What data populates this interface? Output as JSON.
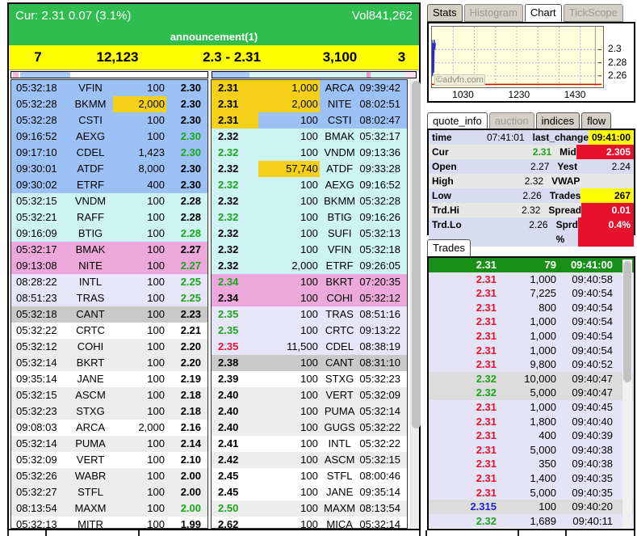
{
  "header": {
    "cur_text": "Cur: 2.31  0.07  (3.1%)",
    "vol_text": "Vol841,262",
    "announcement": "announcement(1)",
    "summary": [
      "7",
      "12,123",
      "2.3 - 2.31",
      "3,100",
      "3"
    ]
  },
  "book": {
    "bid_rows": [
      {
        "t": "05:32:18",
        "mm": "VFIN",
        "sz": "100",
        "p": "2.30",
        "lv": "blue"
      },
      {
        "t": "05:32:28",
        "mm": "BKMM",
        "sz": "2,000",
        "p": "2.30",
        "lv": "blue",
        "szhl": true
      },
      {
        "t": "05:32:28",
        "mm": "CSTI",
        "sz": "100",
        "p": "2.30",
        "lv": "blue"
      },
      {
        "t": "09:16:52",
        "mm": "AEXG",
        "sz": "100",
        "p": "2.30",
        "lv": "blue",
        "pc": "g"
      },
      {
        "t": "09:17:10",
        "mm": "CDEL",
        "sz": "1,423",
        "p": "2.30",
        "lv": "blue",
        "pc": "g"
      },
      {
        "t": "09:30:01",
        "mm": "ATDF",
        "sz": "8,000",
        "p": "2.30",
        "lv": "blue"
      },
      {
        "t": "09:30:02",
        "mm": "ETRF",
        "sz": "400",
        "p": "2.30",
        "lv": "blue"
      },
      {
        "t": "05:32:15",
        "mm": "VNDM",
        "sz": "100",
        "p": "2.28",
        "lv": "cyan"
      },
      {
        "t": "05:32:21",
        "mm": "RAFF",
        "sz": "100",
        "p": "2.28",
        "lv": "cyan"
      },
      {
        "t": "09:16:09",
        "mm": "BTIG",
        "sz": "100",
        "p": "2.28",
        "lv": "cyan",
        "pc": "g"
      },
      {
        "t": "05:32:17",
        "mm": "BMAK",
        "sz": "100",
        "p": "2.27",
        "lv": "pink"
      },
      {
        "t": "09:13:08",
        "mm": "NITE",
        "sz": "100",
        "p": "2.27",
        "lv": "pink",
        "pc": "g"
      },
      {
        "t": "08:28:22",
        "mm": "INTL",
        "sz": "100",
        "p": "2.25",
        "lv": "lav",
        "pc": "g"
      },
      {
        "t": "08:51:23",
        "mm": "TRAS",
        "sz": "100",
        "p": "2.25",
        "lv": "lav",
        "pc": "g"
      },
      {
        "t": "05:32:18",
        "mm": "CANT",
        "sz": "100",
        "p": "2.23",
        "lv": "gray"
      },
      {
        "t": "05:32:22",
        "mm": "CRTC",
        "sz": "100",
        "p": "2.21",
        "lv": "white"
      },
      {
        "t": "05:32:12",
        "mm": "COHI",
        "sz": "100",
        "p": "2.20",
        "lv": "alt"
      },
      {
        "t": "05:32:14",
        "mm": "BKRT",
        "sz": "100",
        "p": "2.20",
        "lv": "alt"
      },
      {
        "t": "09:35:14",
        "mm": "JANE",
        "sz": "100",
        "p": "2.19",
        "lv": "white"
      },
      {
        "t": "05:32:15",
        "mm": "ASCM",
        "sz": "100",
        "p": "2.18",
        "lv": "alt"
      },
      {
        "t": "05:32:23",
        "mm": "STXG",
        "sz": "100",
        "p": "2.18",
        "lv": "alt"
      },
      {
        "t": "09:08:03",
        "mm": "ARCA",
        "sz": "2,000",
        "p": "2.16",
        "lv": "white"
      },
      {
        "t": "05:32:14",
        "mm": "PUMA",
        "sz": "100",
        "p": "2.14",
        "lv": "alt"
      },
      {
        "t": "05:32:09",
        "mm": "VERT",
        "sz": "100",
        "p": "2.10",
        "lv": "white"
      },
      {
        "t": "05:32:26",
        "mm": "WABR",
        "sz": "100",
        "p": "2.00",
        "lv": "alt"
      },
      {
        "t": "05:32:27",
        "mm": "STFL",
        "sz": "100",
        "p": "2.00",
        "lv": "alt"
      },
      {
        "t": "08:13:54",
        "mm": "MAXM",
        "sz": "100",
        "p": "2.00",
        "lv": "alt",
        "pc": "g"
      },
      {
        "t": "05:32:13",
        "mm": "MITR",
        "sz": "100",
        "p": "1.99",
        "lv": "white"
      }
    ],
    "ask_rows": [
      {
        "p": "2.31",
        "sz": "1,000",
        "mm": "ARCA",
        "t": "09:39:42",
        "lv": "blue",
        "phl": true,
        "szhl": true
      },
      {
        "p": "2.31",
        "sz": "2,000",
        "mm": "NITE",
        "t": "08:02:51",
        "lv": "blue",
        "phl": true,
        "szhl": true
      },
      {
        "p": "2.31",
        "sz": "100",
        "mm": "CSTI",
        "t": "08:02:47",
        "lv": "blue",
        "phl": true
      },
      {
        "p": "2.32",
        "sz": "100",
        "mm": "BMAK",
        "t": "05:32:17",
        "lv": "cyan"
      },
      {
        "p": "2.32",
        "sz": "100",
        "mm": "VNDM",
        "t": "09:13:36",
        "lv": "cyan",
        "pc": "g"
      },
      {
        "p": "2.32",
        "sz": "57,740",
        "mm": "ATDF",
        "t": "09:33:28",
        "lv": "cyan",
        "szhl": true
      },
      {
        "p": "2.32",
        "sz": "100",
        "mm": "AEXG",
        "t": "09:16:52",
        "lv": "cyan",
        "pc": "g"
      },
      {
        "p": "2.32",
        "sz": "100",
        "mm": "BKMM",
        "t": "05:32:28",
        "lv": "cyan"
      },
      {
        "p": "2.32",
        "sz": "100",
        "mm": "BTIG",
        "t": "09:16:26",
        "lv": "cyan",
        "pc": "g"
      },
      {
        "p": "2.32",
        "sz": "100",
        "mm": "SUFI",
        "t": "05:32:13",
        "lv": "cyan"
      },
      {
        "p": "2.32",
        "sz": "100",
        "mm": "VFIN",
        "t": "05:32:18",
        "lv": "cyan"
      },
      {
        "p": "2.32",
        "sz": "2,000",
        "mm": "ETRF",
        "t": "09:26:05",
        "lv": "cyan"
      },
      {
        "p": "2.34",
        "sz": "100",
        "mm": "BKRT",
        "t": "07:20:35",
        "lv": "pink",
        "pc": "g"
      },
      {
        "p": "2.34",
        "sz": "100",
        "mm": "COHI",
        "t": "05:32:12",
        "lv": "pink"
      },
      {
        "p": "2.35",
        "sz": "100",
        "mm": "TRAS",
        "t": "08:51:16",
        "lv": "lav",
        "pc": "g"
      },
      {
        "p": "2.35",
        "sz": "100",
        "mm": "CRTC",
        "t": "09:13:22",
        "lv": "lav",
        "pc": "g"
      },
      {
        "p": "2.35",
        "sz": "11,500",
        "mm": "CDEL",
        "t": "08:38:19",
        "lv": "lav",
        "pc": "r"
      },
      {
        "p": "2.38",
        "sz": "100",
        "mm": "CANT",
        "t": "08:31:10",
        "lv": "gray"
      },
      {
        "p": "2.39",
        "sz": "100",
        "mm": "STXG",
        "t": "05:32:23",
        "lv": "white"
      },
      {
        "p": "2.40",
        "sz": "100",
        "mm": "VERT",
        "t": "05:32:09",
        "lv": "alt"
      },
      {
        "p": "2.40",
        "sz": "100",
        "mm": "PUMA",
        "t": "05:32:14",
        "lv": "alt"
      },
      {
        "p": "2.40",
        "sz": "100",
        "mm": "GUGS",
        "t": "05:32:22",
        "lv": "alt"
      },
      {
        "p": "2.41",
        "sz": "100",
        "mm": "INTL",
        "t": "05:32:22",
        "lv": "white"
      },
      {
        "p": "2.42",
        "sz": "100",
        "mm": "ASCM",
        "t": "05:32:15",
        "lv": "alt"
      },
      {
        "p": "2.45",
        "sz": "100",
        "mm": "STFL",
        "t": "08:00:46",
        "lv": "white"
      },
      {
        "p": "2.45",
        "sz": "100",
        "mm": "JANE",
        "t": "09:35:14",
        "lv": "white"
      },
      {
        "p": "2.50",
        "sz": "100",
        "mm": "MAXM",
        "t": "08:13:54",
        "lv": "alt",
        "pc": "g"
      },
      {
        "p": "2.62",
        "sz": "100",
        "mm": "MICA",
        "t": "05:32:14",
        "lv": "white"
      }
    ]
  },
  "tabs_top": [
    {
      "label": "Stats",
      "state": "normal"
    },
    {
      "label": "Histogram",
      "state": "disabled"
    },
    {
      "label": "Chart",
      "state": "active"
    },
    {
      "label": "TickScope",
      "state": "disabled"
    }
  ],
  "chart_data": {
    "type": "line",
    "title": "intraday price mini-chart",
    "watermark": "©advfn.com",
    "grid": true,
    "plot_bg": "#ffffdd",
    "x_axis": {
      "range_minutes": [
        916,
        1522
      ],
      "tick_minutes": [
        1030,
        1230,
        1430
      ],
      "ticks": [
        "1030",
        "1230",
        "1430"
      ]
    },
    "y_axis": {
      "range": [
        2.245,
        2.335
      ],
      "tick_values": [
        2.3,
        2.28,
        2.26
      ],
      "ticks": [
        "2.3",
        "2.28",
        "2.26"
      ],
      "side": "right"
    },
    "series": [
      {
        "name": "price",
        "color": "#2b2bc8",
        "points": [
          [
            916,
            2.315
          ],
          [
            918,
            2.26
          ],
          [
            920,
            2.31
          ],
          [
            922,
            2.265
          ],
          [
            924,
            2.315
          ],
          [
            926,
            2.3
          ],
          [
            928,
            2.31
          ]
        ]
      }
    ],
    "reference_line": {
      "value": 2.247,
      "color": "#dd0000"
    },
    "vertical_line_x": 1500
  },
  "tabs_quote": [
    {
      "label": "quote_info",
      "state": "active"
    },
    {
      "label": "auction",
      "state": "disabled"
    },
    {
      "label": "indices",
      "state": "normal"
    },
    {
      "label": "flow",
      "state": "normal"
    }
  ],
  "quote_rows": [
    {
      "l1": "time",
      "v1": "07:41:01",
      "l2": "last_change",
      "v2": "09:41:00",
      "v2s": "yellow"
    },
    {
      "l1": "Cur",
      "v1": "2.31",
      "v1s": "green",
      "l2": "Mid",
      "v2": "2.305",
      "v2s": "red"
    },
    {
      "l1": "Open",
      "v1": "2.27",
      "l2": "Yest",
      "v2": "2.24"
    },
    {
      "l1": "High",
      "v1": "2.32",
      "l2": "VWAP",
      "v2": ""
    },
    {
      "l1": "Low",
      "v1": "2.26",
      "l2": "Trades",
      "v2": "267",
      "v2s": "yellow"
    },
    {
      "l1": "Trd.Hi",
      "v1": "2.32",
      "l2": "Spread",
      "v2": "0.01",
      "v2s": "red"
    },
    {
      "l1": "Trd.Lo",
      "v1": "2.26",
      "l2": "Sprd %",
      "v2": "0.4%",
      "v2s": "red"
    }
  ],
  "trades_tab": "Trades",
  "trades": [
    {
      "p": "2.31",
      "sz": "79",
      "t": "09:41:00",
      "pc": "w",
      "bg": "green"
    },
    {
      "p": "2.31",
      "sz": "1,000",
      "t": "09:40:58",
      "pc": "r",
      "bg": "lav"
    },
    {
      "p": "2.31",
      "sz": "7,225",
      "t": "09:40:54",
      "pc": "r",
      "bg": "lav"
    },
    {
      "p": "2.31",
      "sz": "800",
      "t": "09:40:54",
      "pc": "r",
      "bg": "lav"
    },
    {
      "p": "2.31",
      "sz": "1,000",
      "t": "09:40:54",
      "pc": "r",
      "bg": "lav"
    },
    {
      "p": "2.31",
      "sz": "1,000",
      "t": "09:40:54",
      "pc": "r",
      "bg": "lav"
    },
    {
      "p": "2.31",
      "sz": "1,000",
      "t": "09:40:54",
      "pc": "r",
      "bg": "lav"
    },
    {
      "p": "2.31",
      "sz": "9,800",
      "t": "09:40:52",
      "pc": "r",
      "bg": "lav"
    },
    {
      "p": "2.32",
      "sz": "10,000",
      "t": "09:40:47",
      "pc": "g",
      "bg": "gray"
    },
    {
      "p": "2.32",
      "sz": "5,000",
      "t": "09:40:47",
      "pc": "g",
      "bg": "gray"
    },
    {
      "p": "2.31",
      "sz": "1,000",
      "t": "09:40:45",
      "pc": "r",
      "bg": "lav"
    },
    {
      "p": "2.31",
      "sz": "1,800",
      "t": "09:40:40",
      "pc": "r",
      "bg": "lav"
    },
    {
      "p": "2.31",
      "sz": "400",
      "t": "09:40:39",
      "pc": "r",
      "bg": "lav"
    },
    {
      "p": "2.31",
      "sz": "5,000",
      "t": "09:40:38",
      "pc": "r",
      "bg": "lav"
    },
    {
      "p": "2.31",
      "sz": "350",
      "t": "09:40:38",
      "pc": "r",
      "bg": "lav"
    },
    {
      "p": "2.31",
      "sz": "1,400",
      "t": "09:40:35",
      "pc": "r",
      "bg": "lav"
    },
    {
      "p": "2.31",
      "sz": "5,000",
      "t": "09:40:35",
      "pc": "r",
      "bg": "lav"
    },
    {
      "p": "2.315",
      "sz": "100",
      "t": "09:40:20",
      "pc": "b",
      "bg": "gray"
    },
    {
      "p": "2.32",
      "sz": "1,689",
      "t": "09:40:11",
      "pc": "g",
      "bg": "lav"
    }
  ],
  "colors": {
    "header_green": "#2ebd4e",
    "summary_yellow": "#ffff00",
    "highlight_gold": "#f5d018",
    "level_blue": "#9cc2f5",
    "level_cyan": "#cdf3f2",
    "level_pink": "#eca8db",
    "level_lavender": "#e6e6f8",
    "level_gray": "#c9c9c9",
    "up_green": "#1ba51b",
    "down_red": "#e8112d",
    "mid_price_blue": "#2222cc",
    "last_trade_row_green": "#189018",
    "alert_red_bg": "#e8112d",
    "alert_yellow_bg": "#ffff00"
  }
}
